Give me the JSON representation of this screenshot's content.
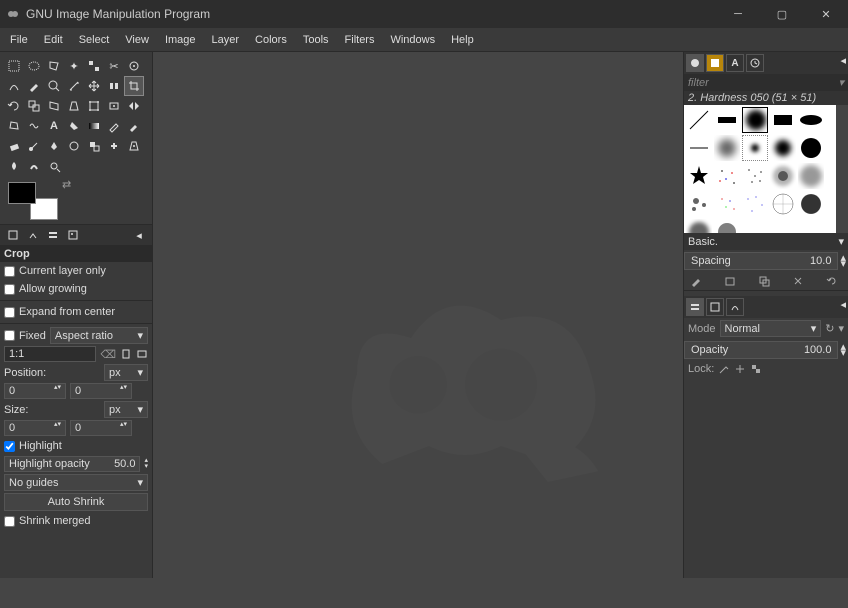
{
  "window": {
    "title": "GNU Image Manipulation Program"
  },
  "menu": [
    "File",
    "Edit",
    "Select",
    "View",
    "Image",
    "Layer",
    "Colors",
    "Tools",
    "Filters",
    "Windows",
    "Help"
  ],
  "tool_options": {
    "header": "Crop",
    "current_layer_only": "Current layer only",
    "allow_growing": "Allow growing",
    "expand_from_center": "Expand from center",
    "fixed": "Fixed",
    "aspect_ratio": "Aspect ratio",
    "ratio_value": "1:1",
    "position_label": "Position:",
    "position_unit": "px",
    "pos_x": "0",
    "pos_y": "0",
    "size_label": "Size:",
    "size_unit": "px",
    "size_w": "0",
    "size_h": "0",
    "highlight": "Highlight",
    "highlight_opacity_label": "Highlight opacity",
    "highlight_opacity_value": "50.0",
    "guides": "No guides",
    "auto_shrink": "Auto Shrink",
    "shrink_merged": "Shrink merged"
  },
  "brushes": {
    "filter_placeholder": "filter",
    "selected_label": "2. Hardness 050 (51 × 51)",
    "presets": "Basic.",
    "spacing_label": "Spacing",
    "spacing_value": "10.0"
  },
  "layers": {
    "mode_label": "Mode",
    "mode_value": "Normal",
    "opacity_label": "Opacity",
    "opacity_value": "100.0",
    "lock_label": "Lock:"
  }
}
